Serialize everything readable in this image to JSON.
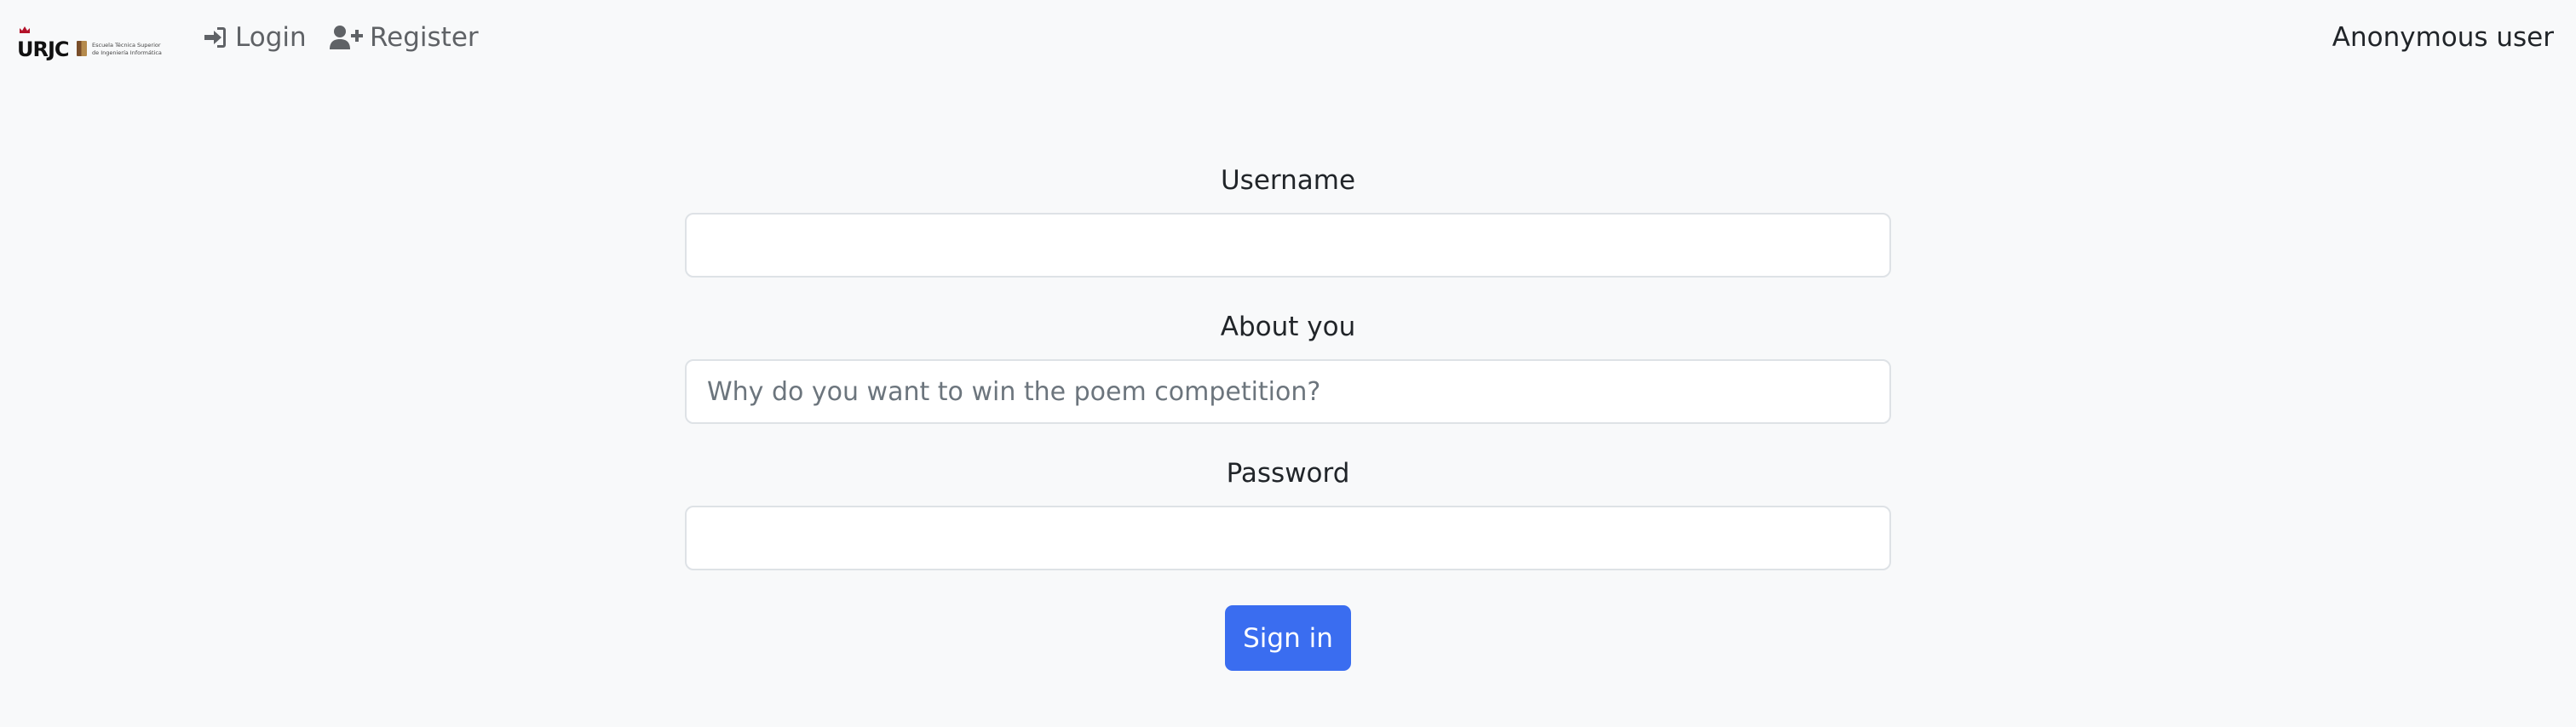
{
  "brand": {
    "letters": "URJC",
    "school_line1": "Escuela Técnica Superior",
    "school_line2": "de Ingeniería Informática"
  },
  "nav": {
    "login_label": "Login",
    "register_label": "Register",
    "user_label": "Anonymous user"
  },
  "form": {
    "username": {
      "label": "Username",
      "value": "",
      "placeholder": ""
    },
    "about": {
      "label": "About you",
      "value": "",
      "placeholder": "Why do you want to win the poem competition?"
    },
    "password": {
      "label": "Password",
      "value": "",
      "placeholder": ""
    },
    "submit_label": "Sign in"
  },
  "colors": {
    "page_background": "#f8f9fa",
    "primary_button": "#3a6df0",
    "nav_text": "#5f6266",
    "input_border": "#dee2e6"
  },
  "icons": {
    "login": "sign-in-icon",
    "register": "user-plus-icon",
    "crown": "crown-icon"
  }
}
